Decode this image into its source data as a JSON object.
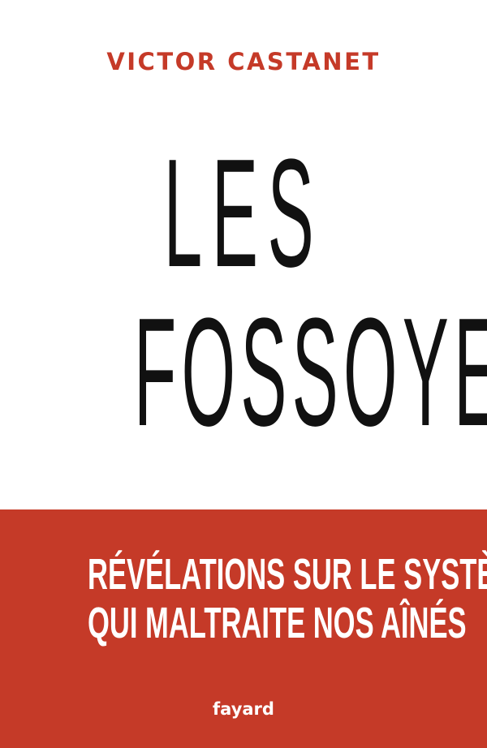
{
  "cover": {
    "author": "VICTOR CASTANET",
    "title_lines": [
      "LES",
      "FOSSOYEURS"
    ],
    "subtitle_lines": [
      "RÉVÉLATIONS SUR LE SYSTÈME",
      "QUI MALTRAITE NOS AÎNÉS"
    ],
    "publisher": "fayard",
    "colors": {
      "accent": "#c53a28",
      "background": "#ffffff",
      "title": "#111111",
      "band_text": "#ffffff"
    }
  }
}
